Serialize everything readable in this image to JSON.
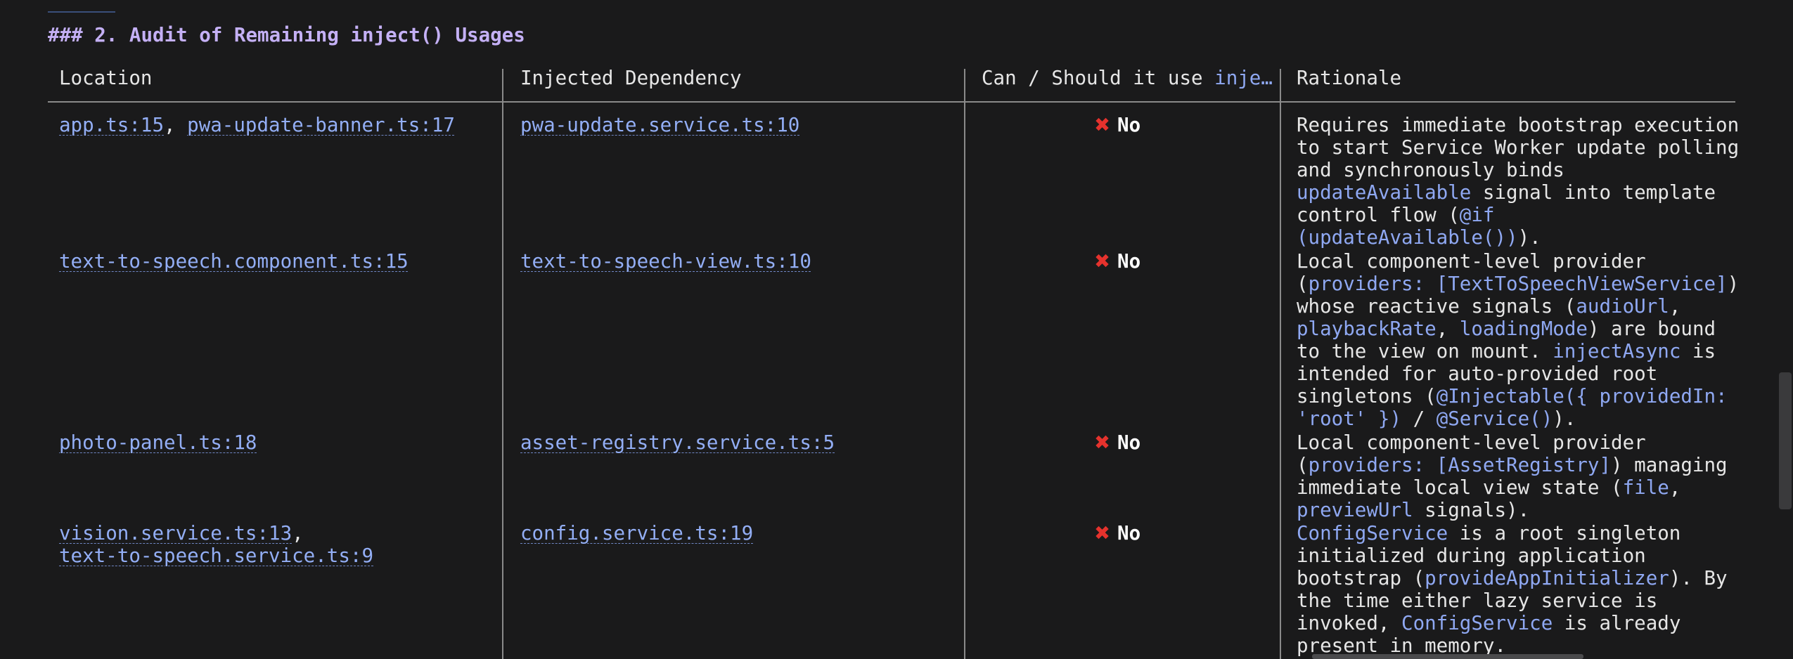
{
  "heading": {
    "prefix": "### 2. Audit of Remaining ",
    "code": "inject()",
    "suffix": " Usages"
  },
  "table": {
    "headers": {
      "location": "Location",
      "dependency": "Injected Dependency",
      "can_prefix": "Can / Should it use ",
      "can_code": "inje…",
      "rationale": "Rationale"
    },
    "rows": [
      {
        "location": [
          {
            "text": "app.ts:15",
            "type": "link"
          },
          {
            "text": ", ",
            "type": "plain"
          },
          {
            "text": "pwa-update-banner.ts:17",
            "type": "link"
          }
        ],
        "dependency": "pwa-update.service.ts:10",
        "verdict": "No",
        "rationale": [
          [
            {
              "text": "Requires immediate bootstrap execution",
              "type": "plain"
            }
          ],
          [
            {
              "text": "to start Service Worker update polling",
              "type": "plain"
            }
          ],
          [
            {
              "text": "and synchronously binds",
              "type": "plain"
            }
          ],
          [
            {
              "text": "updateAvailable",
              "type": "code"
            },
            {
              "text": " signal into template",
              "type": "plain"
            }
          ],
          [
            {
              "text": "control flow (",
              "type": "plain"
            },
            {
              "text": "@if",
              "type": "code"
            }
          ],
          [
            {
              "text": "(updateAvailable())",
              "type": "code"
            },
            {
              "text": ").",
              "type": "plain"
            }
          ]
        ]
      },
      {
        "location": [
          {
            "text": "text-to-speech.component.ts:15",
            "type": "link"
          }
        ],
        "dependency": "text-to-speech-view.ts:10",
        "verdict": "No",
        "rationale": [
          [
            {
              "text": "Local component-level provider",
              "type": "plain"
            }
          ],
          [
            {
              "text": "(",
              "type": "plain"
            },
            {
              "text": "providers: [TextToSpeechViewService]",
              "type": "code"
            },
            {
              "text": ")",
              "type": "plain"
            }
          ],
          [
            {
              "text": "whose reactive signals (",
              "type": "plain"
            },
            {
              "text": "audioUrl",
              "type": "code"
            },
            {
              "text": ",",
              "type": "plain"
            }
          ],
          [
            {
              "text": "playbackRate",
              "type": "code"
            },
            {
              "text": ", ",
              "type": "plain"
            },
            {
              "text": "loadingMode",
              "type": "code"
            },
            {
              "text": ") are bound",
              "type": "plain"
            }
          ],
          [
            {
              "text": "to the view on mount. ",
              "type": "plain"
            },
            {
              "text": "injectAsync",
              "type": "code"
            },
            {
              "text": " is",
              "type": "plain"
            }
          ],
          [
            {
              "text": "intended for auto-provided root",
              "type": "plain"
            }
          ],
          [
            {
              "text": "singletons (",
              "type": "plain"
            },
            {
              "text": "@Injectable({ providedIn:",
              "type": "code"
            }
          ],
          [
            {
              "text": "'root' })",
              "type": "code"
            },
            {
              "text": " / ",
              "type": "plain"
            },
            {
              "text": "@Service()",
              "type": "code"
            },
            {
              "text": ").",
              "type": "plain"
            }
          ]
        ]
      },
      {
        "location": [
          {
            "text": "photo-panel.ts:18",
            "type": "link"
          }
        ],
        "dependency": "asset-registry.service.ts:5",
        "verdict": "No",
        "rationale": [
          [
            {
              "text": "Local component-level provider",
              "type": "plain"
            }
          ],
          [
            {
              "text": "(",
              "type": "plain"
            },
            {
              "text": "providers: [AssetRegistry]",
              "type": "code"
            },
            {
              "text": ") managing",
              "type": "plain"
            }
          ],
          [
            {
              "text": "immediate local view state (",
              "type": "plain"
            },
            {
              "text": "file",
              "type": "code"
            },
            {
              "text": ",",
              "type": "plain"
            }
          ],
          [
            {
              "text": "previewUrl",
              "type": "code"
            },
            {
              "text": " signals).",
              "type": "plain"
            }
          ]
        ]
      },
      {
        "location": [
          {
            "text": "vision.service.ts:13",
            "type": "link"
          },
          {
            "text": ",",
            "type": "plain"
          },
          {
            "text": "\n",
            "type": "break"
          },
          {
            "text": "text-to-speech.service.ts:9",
            "type": "link"
          }
        ],
        "dependency": "config.service.ts:19",
        "verdict": "No",
        "rationale": [
          [
            {
              "text": "ConfigService",
              "type": "code"
            },
            {
              "text": " is a root singleton",
              "type": "plain"
            }
          ],
          [
            {
              "text": "initialized during application",
              "type": "plain"
            }
          ],
          [
            {
              "text": "bootstrap (",
              "type": "plain"
            },
            {
              "text": "provideAppInitializer",
              "type": "code"
            },
            {
              "text": "). By",
              "type": "plain"
            }
          ],
          [
            {
              "text": "the time either lazy service is",
              "type": "plain"
            }
          ],
          [
            {
              "text": "invoked, ",
              "type": "plain"
            },
            {
              "text": "ConfigService",
              "type": "code"
            },
            {
              "text": " is already",
              "type": "plain"
            }
          ],
          [
            {
              "text": "present in memory.",
              "type": "plain"
            }
          ]
        ]
      }
    ]
  },
  "icons": {
    "verdict_icon": "x-mark-icon",
    "verdict_color": "#e5322d"
  }
}
